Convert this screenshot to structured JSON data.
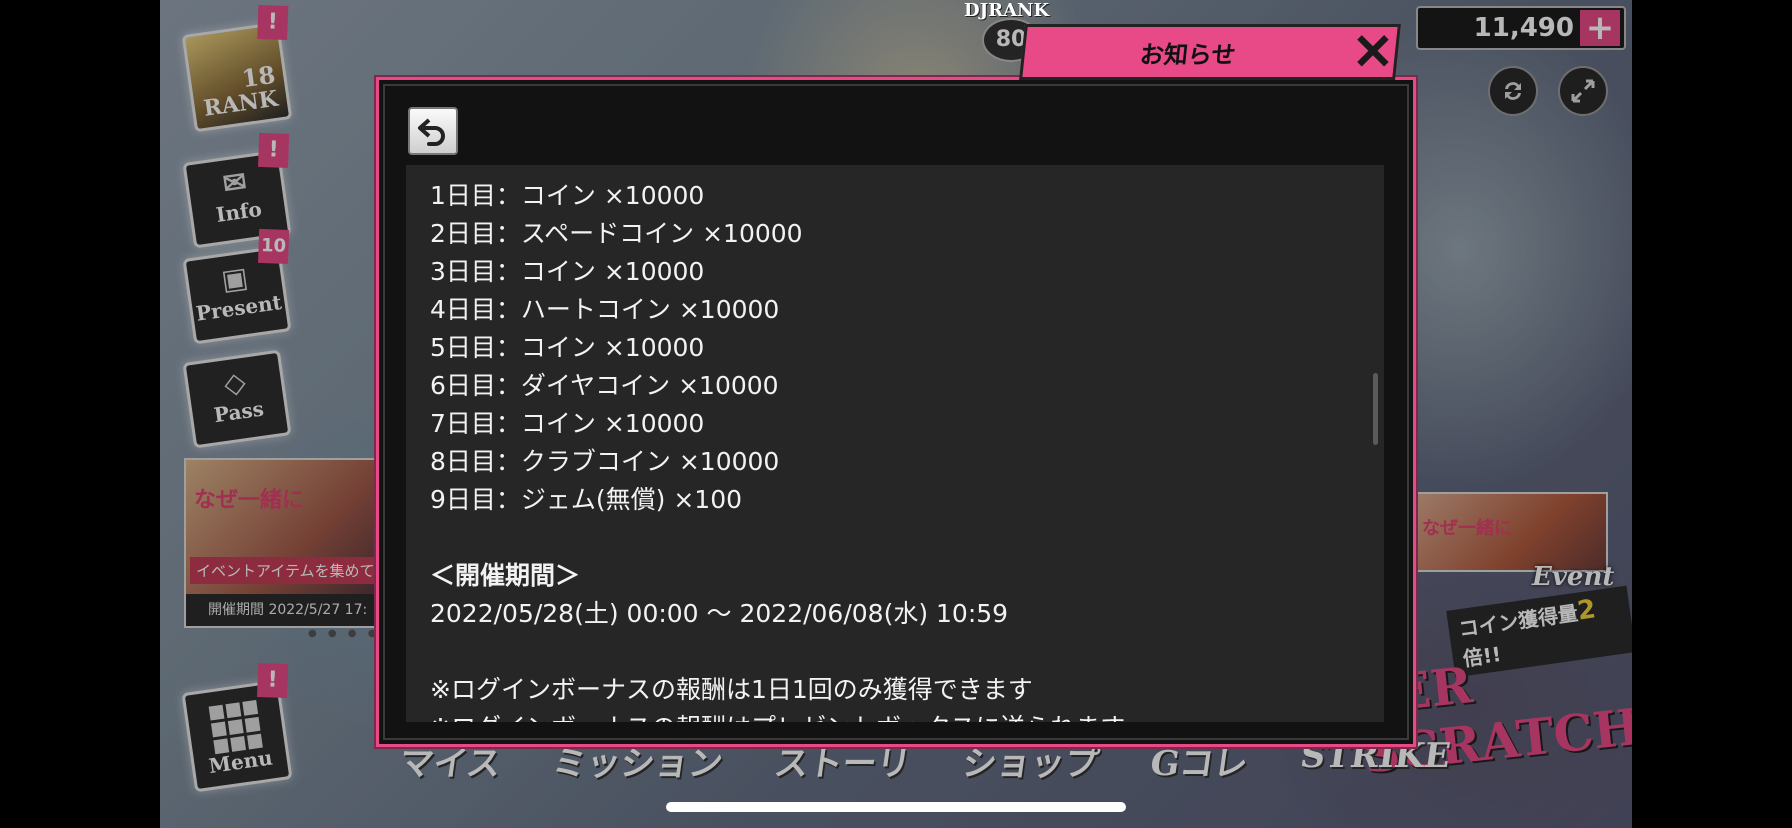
{
  "dialog": {
    "title": "お知らせ",
    "close_label": "✕",
    "content_lines": [
      "1日目：コイン ×10000",
      "2日目：スペードコイン ×10000",
      "3日目：コイン ×10000",
      "4日目：ハートコイン ×10000",
      "5日目：コイン ×10000",
      "6日目：ダイヤコイン ×10000",
      "7日目：コイン ×10000",
      "8日目：クラブコイン ×10000",
      "9日目：ジェム(無償) ×100",
      "",
      "＜開催期間＞",
      "2022/05/28(土) 00:00 〜 2022/06/08(水) 10:59",
      "",
      "※ログインボーナスの報酬は1日1回のみ獲得できます",
      "※ログインボーナスの報酬はプレゼントボックスに送られます"
    ]
  },
  "header": {
    "djrank_label": "DJRANK",
    "djrank_value": "80",
    "gem_count": "11,490",
    "plus_label": "+"
  },
  "sidebar": {
    "rank": {
      "label": "RANK",
      "value": "18",
      "badge": "!"
    },
    "items": [
      {
        "label": "Info",
        "badge": "!",
        "icon": "envelope-icon"
      },
      {
        "label": "Present",
        "badge": "10",
        "icon": "gift-box-icon"
      },
      {
        "label": "Pass",
        "badge": "",
        "icon": "diamond-icon"
      }
    ],
    "menu": {
      "label": "Menu",
      "badge": "!"
    }
  },
  "banners": {
    "left_title": "なぜ一緒に",
    "left_subtitle": "イベントアイテムを集めて",
    "left_period": "開催期間 2022/5/27 17:",
    "right_title": "なぜ一緒に",
    "event_label": "Event",
    "coin_boost_prefix": "コイン獲得量",
    "coin_boost_number": "2",
    "coin_boost_suffix": "倍!!",
    "scratch_logo": "LER SCRATCH!!"
  },
  "bottom_nav": [
    "マイス",
    "ミッション",
    "ストーリ",
    "ショップ",
    "Gコレ",
    "STRIKE"
  ],
  "colors": {
    "accent": "#e84a88",
    "panel": "#262626",
    "dialog_bg": "#121212"
  }
}
